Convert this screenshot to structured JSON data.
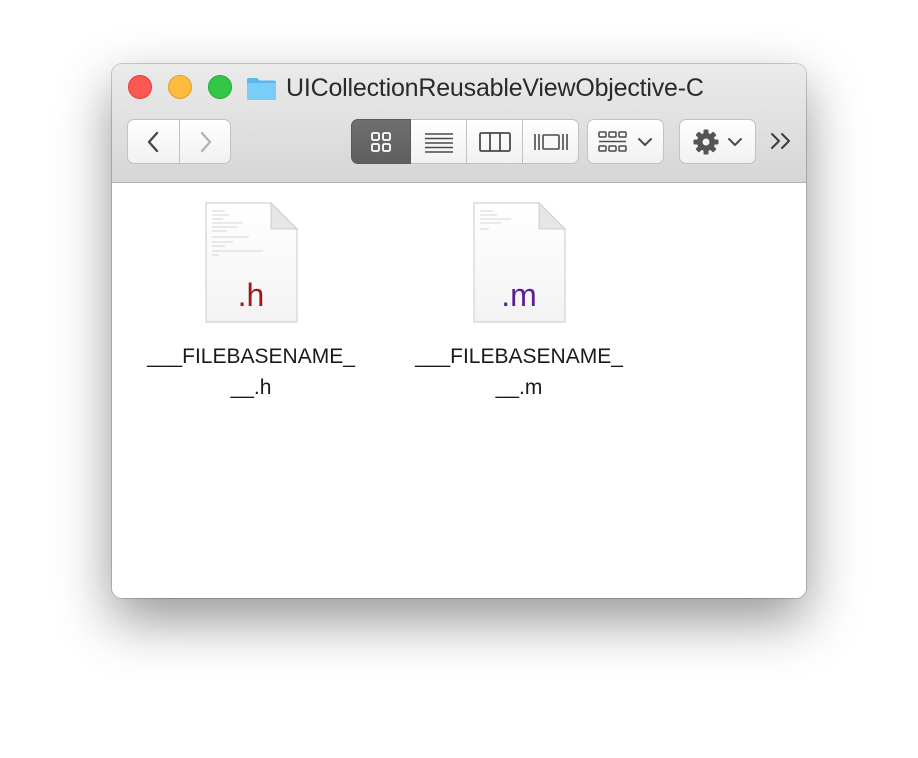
{
  "window": {
    "title": "UICollectionReusableViewObjective-C"
  },
  "toolbar": {
    "back_icon": "chevron-left-icon",
    "forward_icon": "chevron-right-icon",
    "view_modes": [
      "icon-view",
      "list-view",
      "column-view",
      "cover-flow-view"
    ],
    "active_view_mode": "icon-view",
    "arrange_icon": "group-grid-icon",
    "action_icon": "gear-icon",
    "overflow_icon": "double-chevron-right-icon"
  },
  "files": [
    {
      "name_line1": "___FILEBASENAME_",
      "name_line2": "__.h",
      "ext_label": ".h",
      "ext_color": "#a0181c"
    },
    {
      "name_line1": "___FILEBASENAME_",
      "name_line2": "__.m",
      "ext_label": ".m",
      "ext_color": "#5b1e9a"
    }
  ],
  "colors": {
    "close": "#fc5753",
    "minimize": "#fdbc40",
    "maximize": "#33c748",
    "folder": "#6cc3f2"
  }
}
